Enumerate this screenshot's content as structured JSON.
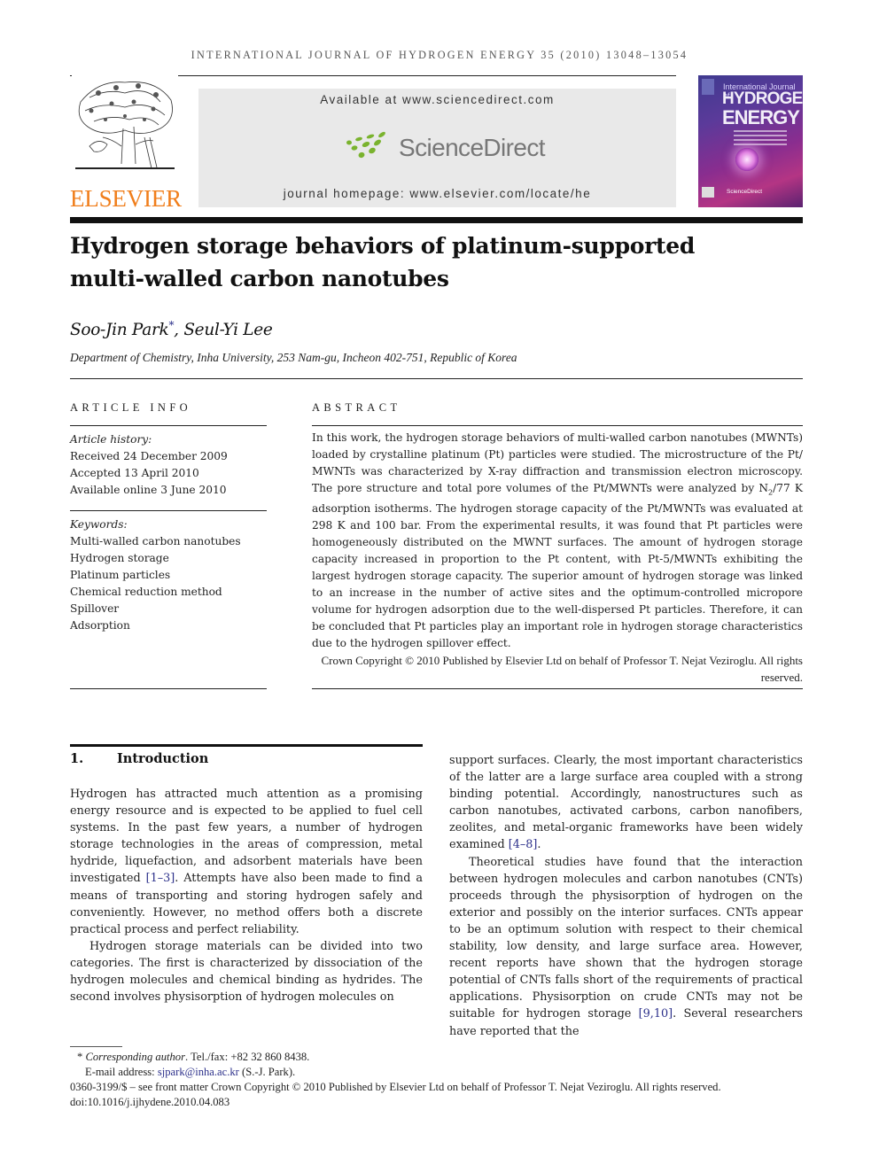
{
  "running_head": "International Journal of Hydrogen Energy 35 (2010) 13048–13054",
  "masthead": {
    "publisher_logo": "ELSEVIER",
    "available_at": "Available at www.sciencedirect.com",
    "platform_logo": "ScienceDirect",
    "journal_homepage": "journal homepage: www.elsevier.com/locate/he",
    "cover": {
      "line1": "International Journal of",
      "line2": "HYDROGEN",
      "line3": "ENERGY",
      "footer_logo": "ScienceDirect"
    }
  },
  "article": {
    "title_line1": "Hydrogen storage behaviors of platinum-supported",
    "title_line2": "multi-walled carbon nanotubes",
    "author1": "Soo-Jin Park",
    "author1_mark": "*",
    "author_sep": ", ",
    "author2": "Seul-Yi Lee",
    "affiliation": "Department of Chemistry, Inha University, 253 Nam-gu, Incheon 402-751, Republic of Korea"
  },
  "article_info": {
    "heading": "Article info",
    "history_label": "Article history:",
    "history": [
      "Received 24 December 2009",
      "Accepted 13 April 2010",
      "Available online 3 June 2010"
    ],
    "keywords_label": "Keywords:",
    "keywords": [
      "Multi-walled carbon nanotubes",
      "Hydrogen storage",
      "Platinum particles",
      "Chemical reduction method",
      "Spillover",
      "Adsorption"
    ]
  },
  "abstract": {
    "heading": "Abstract",
    "text_part1": "In this work, the hydrogen storage behaviors of multi-walled carbon nanotubes (MWNTs) loaded by crystalline platinum (Pt) particles were studied. The microstructure of the Pt/ MWNTs was characterized by X-ray diffraction and transmission electron microscopy. The pore structure and total pore volumes of the Pt/MWNTs were analyzed by N",
    "subscript": "2",
    "text_part2": "/77 K adsorption isotherms. The hydrogen storage capacity of the Pt/MWNTs was evaluated at 298 K and 100 bar. From the experimental results, it was found that Pt particles were homogeneously distributed on the MWNT surfaces. The amount of hydrogen storage capacity increased in proportion to the Pt content, with Pt-5/MWNTs exhibiting the largest hydrogen storage capacity. The superior amount of hydrogen storage was linked to an increase in the number of active sites and the optimum-controlled micropore volume for hydrogen adsorption due to the well-dispersed Pt particles. Therefore, it can be concluded that Pt particles play an important role in hydrogen storage characteristics due to the hydrogen spillover effect.",
    "copyright": "Crown Copyright © 2010 Published by Elsevier Ltd on behalf of Professor T. Nejat Veziroglu. All rights reserved."
  },
  "introduction": {
    "number": "1.",
    "heading": "Introduction",
    "left_p1_a": "Hydrogen has attracted much attention as a promising energy resource and is expected to be applied to fuel cell systems. In the past few years, a number of hydrogen storage technologies in the areas of compression, metal hydride, liquefaction, and adsorbent materials have been investigated ",
    "left_p1_ref": "[1–3]",
    "left_p1_b": ". Attempts have also been made to find a means of transporting and storing hydrogen safely and conveniently. However, no method offers both a discrete practical process and perfect reliability.",
    "left_p2": "Hydrogen storage materials can be divided into two categories. The first is characterized by dissociation of the hydrogen molecules and chemical binding as hydrides. The second involves physisorption of hydrogen molecules on",
    "right_p1_a": "support surfaces. Clearly, the most important characteristics of the latter are a large surface area coupled with a strong binding potential. Accordingly, nanostructures such as carbon nanotubes, activated carbons, carbon nanofibers, zeolites, and metal-organic frameworks have been widely examined ",
    "right_p1_ref": "[4–8]",
    "right_p1_b": ".",
    "right_p2_a": "Theoretical studies have found that the interaction between hydrogen molecules and carbon nanotubes (CNTs) proceeds through the physisorption of hydrogen on the exterior and possibly on the interior surfaces. CNTs appear to be an optimum solution with respect to their chemical stability, low density, and large surface area. However, recent reports have shown that the hydrogen storage potential of CNTs falls short of the requirements of practical applications. Physisorption on crude CNTs may not be suitable for hydrogen storage ",
    "right_p2_ref": "[9,10]",
    "right_p2_b": ". Several researchers have reported that the"
  },
  "footnotes": {
    "mark": "*",
    "corresponding_label": "Corresponding author",
    "tel": ". Tel./fax: +82 32 860 8438.",
    "email_label": "E-mail address: ",
    "email": "sjpark@inha.ac.kr",
    "email_suffix": " (S.-J. Park).",
    "issn_line": "0360-3199/$ – see front matter Crown Copyright © 2010 Published by Elsevier Ltd on behalf of Professor T. Nejat Veziroglu. All rights reserved.",
    "doi": "doi:10.1016/j.ijhydene.2010.04.083"
  }
}
